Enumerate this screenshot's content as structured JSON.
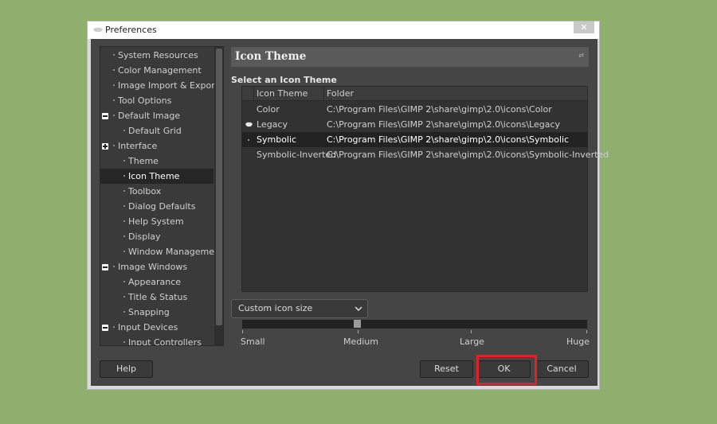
{
  "window": {
    "title": "Preferences",
    "close_label": "✕"
  },
  "nav": {
    "items": [
      {
        "label": "System Resources",
        "level": 1,
        "expander": ""
      },
      {
        "label": "Color Management",
        "level": 1,
        "expander": ""
      },
      {
        "label": "Image Import & Export",
        "level": 1,
        "expander": ""
      },
      {
        "label": "Tool Options",
        "level": 1,
        "expander": ""
      },
      {
        "label": "Default Image",
        "level": 1,
        "expander": "minus"
      },
      {
        "label": "Default Grid",
        "level": 2,
        "expander": ""
      },
      {
        "label": "Interface",
        "level": 1,
        "expander": "plus"
      },
      {
        "label": "Theme",
        "level": 2,
        "expander": ""
      },
      {
        "label": "Icon Theme",
        "level": 2,
        "expander": "",
        "selected": true
      },
      {
        "label": "Toolbox",
        "level": 2,
        "expander": ""
      },
      {
        "label": "Dialog Defaults",
        "level": 2,
        "expander": ""
      },
      {
        "label": "Help System",
        "level": 2,
        "expander": ""
      },
      {
        "label": "Display",
        "level": 2,
        "expander": ""
      },
      {
        "label": "Window Management",
        "level": 2,
        "expander": ""
      },
      {
        "label": "Image Windows",
        "level": 1,
        "expander": "minus"
      },
      {
        "label": "Appearance",
        "level": 2,
        "expander": ""
      },
      {
        "label": "Title & Status",
        "level": 2,
        "expander": ""
      },
      {
        "label": "Snapping",
        "level": 2,
        "expander": ""
      },
      {
        "label": "Input Devices",
        "level": 1,
        "expander": "minus"
      },
      {
        "label": "Input Controllers",
        "level": 2,
        "expander": ""
      }
    ]
  },
  "page": {
    "title": "Icon Theme",
    "section_title": "Select an Icon Theme"
  },
  "table": {
    "columns": [
      "Icon Theme",
      "Folder"
    ],
    "rows": [
      {
        "theme": "Color",
        "folder": "C:\\Program Files\\GIMP 2\\share\\gimp\\2.0\\icons\\Color",
        "icon": ""
      },
      {
        "theme": "Legacy",
        "folder": "C:\\Program Files\\GIMP 2\\share\\gimp\\2.0\\icons\\Legacy",
        "icon": "wilber-icon"
      },
      {
        "theme": "Symbolic",
        "folder": "C:\\Program Files\\GIMP 2\\share\\gimp\\2.0\\icons\\Symbolic",
        "icon": "dot",
        "selected": true
      },
      {
        "theme": "Symbolic-Inverted",
        "folder": "C:\\Program Files\\GIMP 2\\share\\gimp\\2.0\\icons\\Symbolic-Inverted",
        "icon": ""
      }
    ]
  },
  "icon_size": {
    "combo_label": "Custom icon size",
    "slider_value_fraction": 0.33,
    "tick_labels": [
      "Small",
      "Medium",
      "Large",
      "Huge"
    ]
  },
  "buttons": {
    "help": "Help",
    "reset": "Reset",
    "ok": "OK",
    "cancel": "Cancel"
  },
  "colors": {
    "background": "#8faf6f",
    "dialog_bg": "#454545",
    "highlight": "#e0202a"
  }
}
